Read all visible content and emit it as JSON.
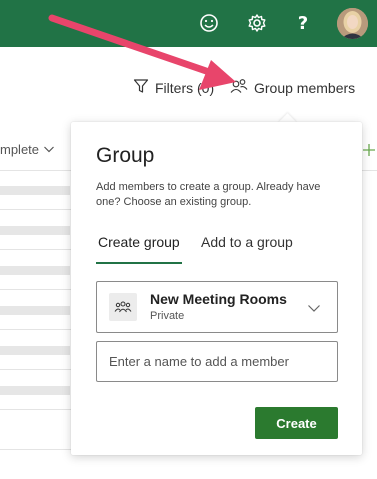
{
  "toolbar": {
    "filters_label": "Filters (0)",
    "group_members_label": "Group members"
  },
  "list": {
    "column_header": "mplete"
  },
  "popover": {
    "title": "Group",
    "description": "Add members to create a group. Already have one? Choose an existing group.",
    "tabs": [
      {
        "label": "Create group",
        "active": true
      },
      {
        "label": "Add to a group",
        "active": false
      }
    ],
    "selected_group": {
      "name": "New Meeting Rooms",
      "privacy": "Private"
    },
    "member_input_placeholder": "Enter a name to add a member",
    "create_label": "Create"
  },
  "icons": {
    "smile": "smile-icon",
    "gear": "gear-icon",
    "help": "help-icon",
    "filter": "filter-icon",
    "people": "people-icon",
    "group": "group-icon",
    "chevron": "chevron-down-icon"
  },
  "colors": {
    "suite_bar": "#217346",
    "accent": "#217346",
    "annotation_arrow": "#e8456b"
  },
  "help_glyph": "?"
}
